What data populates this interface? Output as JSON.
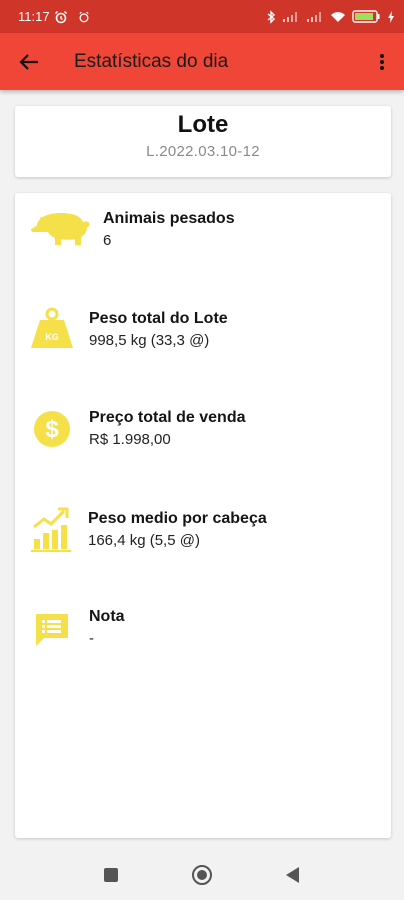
{
  "status_bar": {
    "time": "11:17",
    "battery": "80"
  },
  "app_bar": {
    "title": "Estatísticas do dia",
    "back_icon": "arrow-left-icon",
    "menu_icon": "more-vert-icon"
  },
  "lote": {
    "title": "Lote",
    "code": "L.2022.03.10-12"
  },
  "stats": [
    {
      "label": "Animais pesados",
      "value": "6",
      "icon": "pig-icon"
    },
    {
      "label": "Peso total do Lote",
      "value": "998,5 kg (33,3 @)",
      "icon": "kg-weight-icon"
    },
    {
      "label": "Preço total de venda",
      "value": "R$ 1.998,00",
      "icon": "dollar-coin-icon"
    },
    {
      "label": "Peso medio por cabeça",
      "value": "166,4 kg (5,5 @)",
      "icon": "growth-chart-icon"
    },
    {
      "label": "Nota",
      "value": "-",
      "icon": "note-message-icon"
    }
  ],
  "colors": {
    "status_bar": "#d0352a",
    "app_bar": "#ef4637",
    "icon_yellow": "#f5e04a"
  },
  "nav": {
    "recents_icon": "square-icon",
    "home_icon": "circle-icon",
    "back_icon": "triangle-back-icon"
  }
}
